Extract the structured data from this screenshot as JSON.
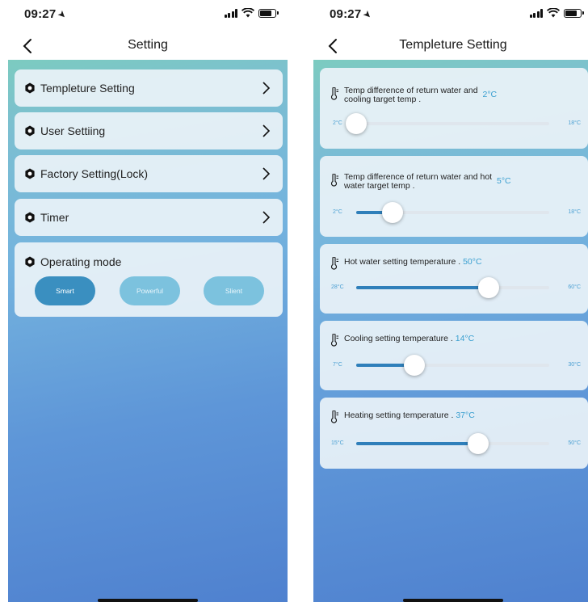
{
  "status_bar": {
    "time": "09:27"
  },
  "left_screen": {
    "title": "Setting",
    "menu_items": [
      {
        "label": "Templeture Setting"
      },
      {
        "label": "User Settiing"
      },
      {
        "label": "Factory Setting(Lock)"
      },
      {
        "label": "Timer"
      }
    ],
    "operating_mode": {
      "label": "Operating mode",
      "options": [
        "Smart",
        "Powerful",
        "Slient"
      ],
      "selected": "Smart"
    }
  },
  "right_screen": {
    "title": "Templeture Setting",
    "sliders": [
      {
        "label_line1": "Temp difference of return water and",
        "label_line2": "cooling target temp .",
        "value": "2°C",
        "min": "2°C",
        "max": "18°C",
        "fraction": 0.0
      },
      {
        "label_line1": "Temp difference of return water and hot",
        "label_line2": "water target temp .",
        "value": "5°C",
        "min": "2°C",
        "max": "18°C",
        "fraction": 0.1875
      },
      {
        "label_line1": "Hot water setting temperature .",
        "label_line2": "",
        "value": "50°C",
        "min": "28°C",
        "max": "60°C",
        "fraction": 0.6875
      },
      {
        "label_line1": "Cooling setting temperature .",
        "label_line2": "",
        "value": "14°C",
        "min": "7°C",
        "max": "30°C",
        "fraction": 0.3
      },
      {
        "label_line1": "Heating setting temperature .",
        "label_line2": "",
        "value": "37°C",
        "min": "15°C",
        "max": "50°C",
        "fraction": 0.63
      }
    ]
  }
}
